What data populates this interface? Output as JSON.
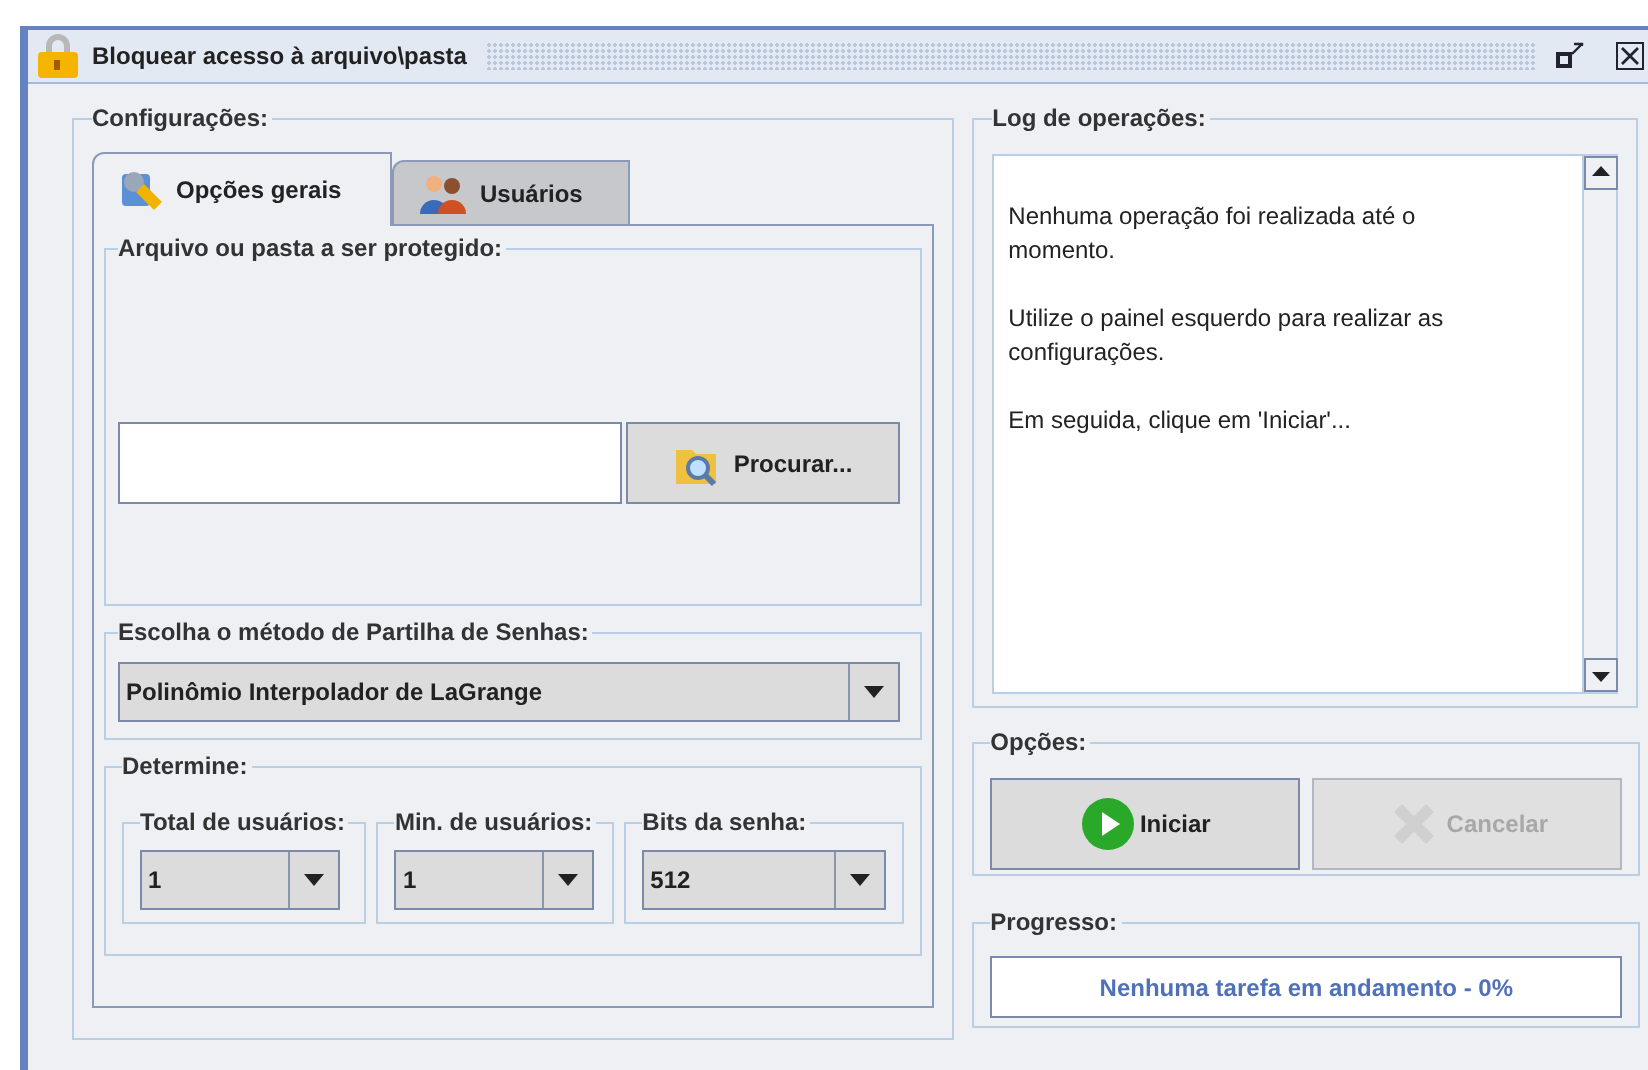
{
  "window": {
    "title": "Bloquear acesso à arquivo\\pasta"
  },
  "config": {
    "title": "Configurações:",
    "tabs": [
      {
        "label": "Opções gerais",
        "selected": true,
        "kind": "settings"
      },
      {
        "label": "Usuários",
        "selected": false,
        "kind": "users"
      }
    ],
    "file_group": {
      "title": "Arquivo ou pasta a ser protegido:",
      "browse_button": "Procurar..."
    },
    "method_group": {
      "title": "Escolha o método de Partilha de Senhas:",
      "value": "Polinômio Interpolador de LaGrange"
    },
    "determine_group": {
      "title": "Determine:",
      "fields": [
        {
          "label": "Total de usuários:",
          "value": "1"
        },
        {
          "label": "Min. de usuários:",
          "value": "1"
        },
        {
          "label": "Bits da senha:",
          "value": "512"
        }
      ]
    }
  },
  "log": {
    "title": "Log de operações:",
    "paragraphs": [
      "Nenhuma operação foi realizada até o momento.",
      "Utilize o painel esquerdo para realizar as configurações.",
      "Em seguida, clique em 'Iniciar'..."
    ]
  },
  "options": {
    "title": "Opções:",
    "buttons": [
      {
        "label": "Iniciar",
        "kind": "start",
        "disabled": false
      },
      {
        "label": "Cancelar",
        "kind": "cancel",
        "disabled": true
      }
    ]
  },
  "progress": {
    "title": "Progresso:",
    "text": "Nenhuma tarefa em andamento - 0%"
  }
}
